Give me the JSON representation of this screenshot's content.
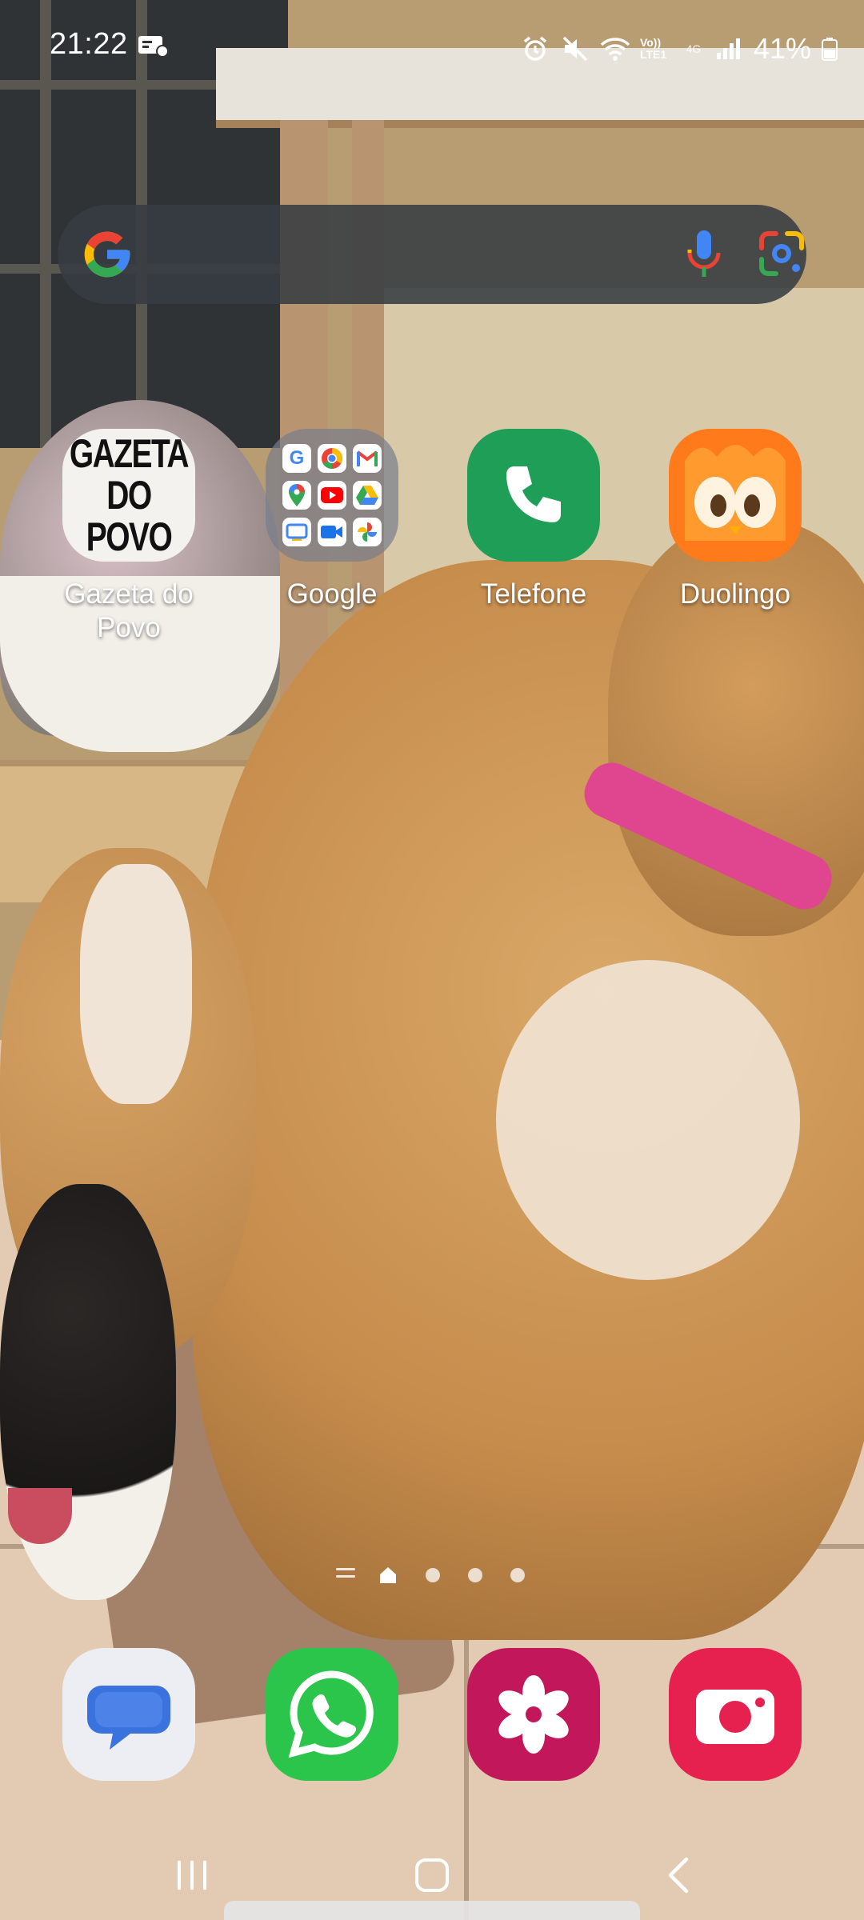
{
  "status_bar": {
    "time": "21:22",
    "battery_percent": "41%",
    "icons": [
      "notification-icon",
      "alarm-icon",
      "mute-icon",
      "wifi-icon",
      "volte-icon",
      "4g-icon",
      "signal-icon",
      "battery-icon"
    ],
    "network_labels": {
      "volte": "Vo)) LTE1",
      "data": "4G"
    }
  },
  "search_widget": {
    "icons": [
      "google-logo-icon",
      "mic-icon",
      "google-lens-icon"
    ],
    "colors": {
      "background": "#373c42",
      "blue": "#4285F4",
      "red": "#EA4335",
      "yellow": "#FBBC05",
      "green": "#34A853"
    }
  },
  "home_apps": [
    {
      "label": "Gazeta do Povo",
      "icon": "gazeta-do-povo-icon",
      "icon_text": [
        "GAZETA",
        "DO POVO"
      ]
    },
    {
      "label": "Google",
      "icon": "google-folder-icon"
    },
    {
      "label": "Telefone",
      "icon": "phone-icon",
      "color": "#1e9e57"
    },
    {
      "label": "Duolingo",
      "icon": "duolingo-icon",
      "color": "#ff7a1a"
    }
  ],
  "google_folder_apps": [
    "google-icon",
    "chrome-icon",
    "gmail-icon",
    "maps-icon",
    "youtube-icon",
    "drive-icon",
    "meet-icon",
    "duo-icon",
    "photos-icon"
  ],
  "page_indicator": {
    "pages": 4,
    "current": 1
  },
  "dock_apps": [
    {
      "label": "Messages",
      "icon": "messages-icon",
      "color": "#4a7fd6"
    },
    {
      "label": "WhatsApp",
      "icon": "whatsapp-icon",
      "color": "#2bc54c"
    },
    {
      "label": "Gallery",
      "icon": "gallery-icon",
      "color": "#c2185b"
    },
    {
      "label": "Camera",
      "icon": "camera-icon",
      "color": "#e6214f"
    }
  ],
  "nav_bar": {
    "buttons": [
      "recent-apps-button",
      "home-button",
      "back-button"
    ]
  }
}
